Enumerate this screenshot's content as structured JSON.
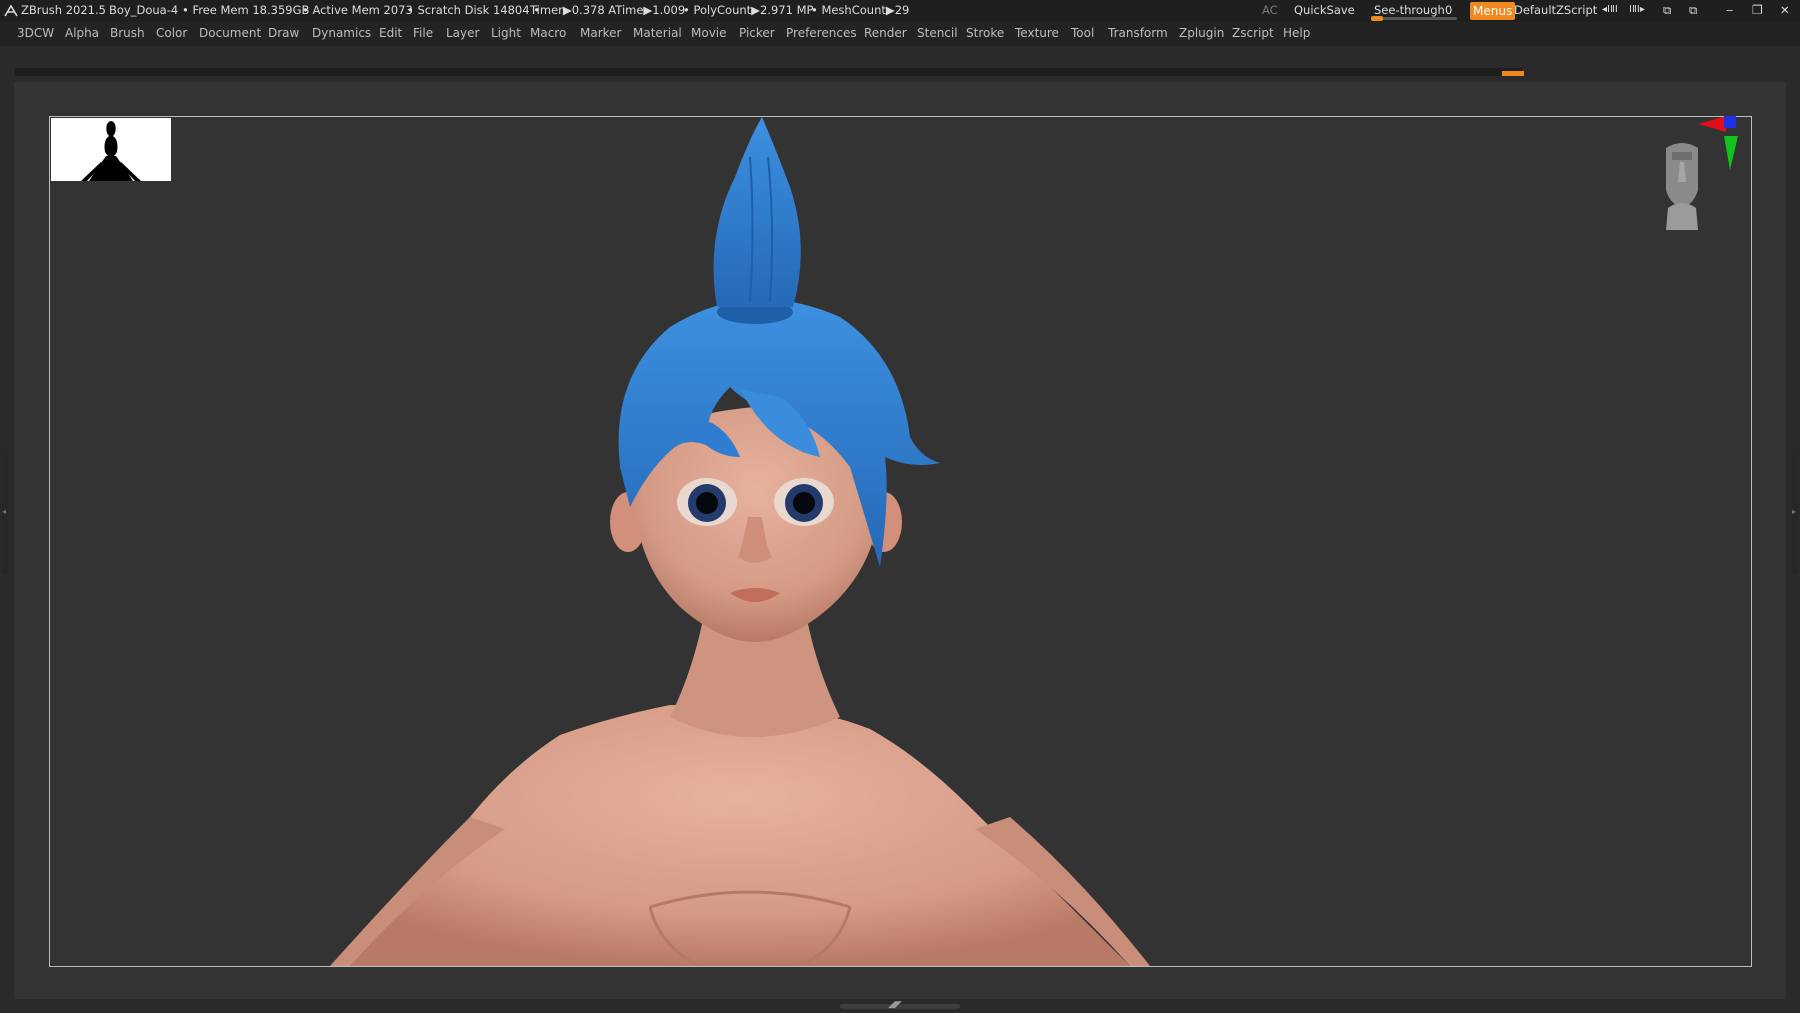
{
  "titlebar": {
    "app_name": "ZBrush 2021.5",
    "document_name": "Boy_Doua-4",
    "free_mem": "• Free Mem 18.359GB",
    "active_mem": "• Active Mem 2073",
    "scratch_disk": "• Scratch Disk 14804 •",
    "timer": "Timer▶0.378 ATime▶1.009",
    "polycount": "• PolyCount▶2.971 MP",
    "meshcount": "• MeshCount▶29",
    "ac_label": "AC",
    "quicksave_label": "QuickSave",
    "seethrough_label": "See-through",
    "seethrough_value": "0",
    "seethrough_level": 0.0,
    "menus_label": "Menus",
    "script_label": "DefaultZScript",
    "accent_color": "#ef8a20"
  },
  "menubar": {
    "items": [
      "3DCW",
      "Alpha",
      "Brush",
      "Color",
      "Document",
      "Draw",
      "Dynamics",
      "Edit",
      "File",
      "Layer",
      "Light",
      "Macro",
      "Marker",
      "Material",
      "Movie",
      "Picker",
      "Preferences",
      "Render",
      "Stencil",
      "Stroke",
      "Texture",
      "Tool",
      "Transform",
      "Zplugin",
      "Zscript",
      "Help"
    ]
  },
  "icons": {
    "app_logo": "zbrush-logo-icon",
    "navigator": "head-navigator-icon",
    "axis_gizmo": "axis-gizmo-icon"
  },
  "colors": {
    "hair": "#2f7fd0",
    "skin": "#d79c86",
    "axis_x": "#e0101a",
    "axis_y": "#10c41c",
    "axis_z": "#1a33e6"
  }
}
